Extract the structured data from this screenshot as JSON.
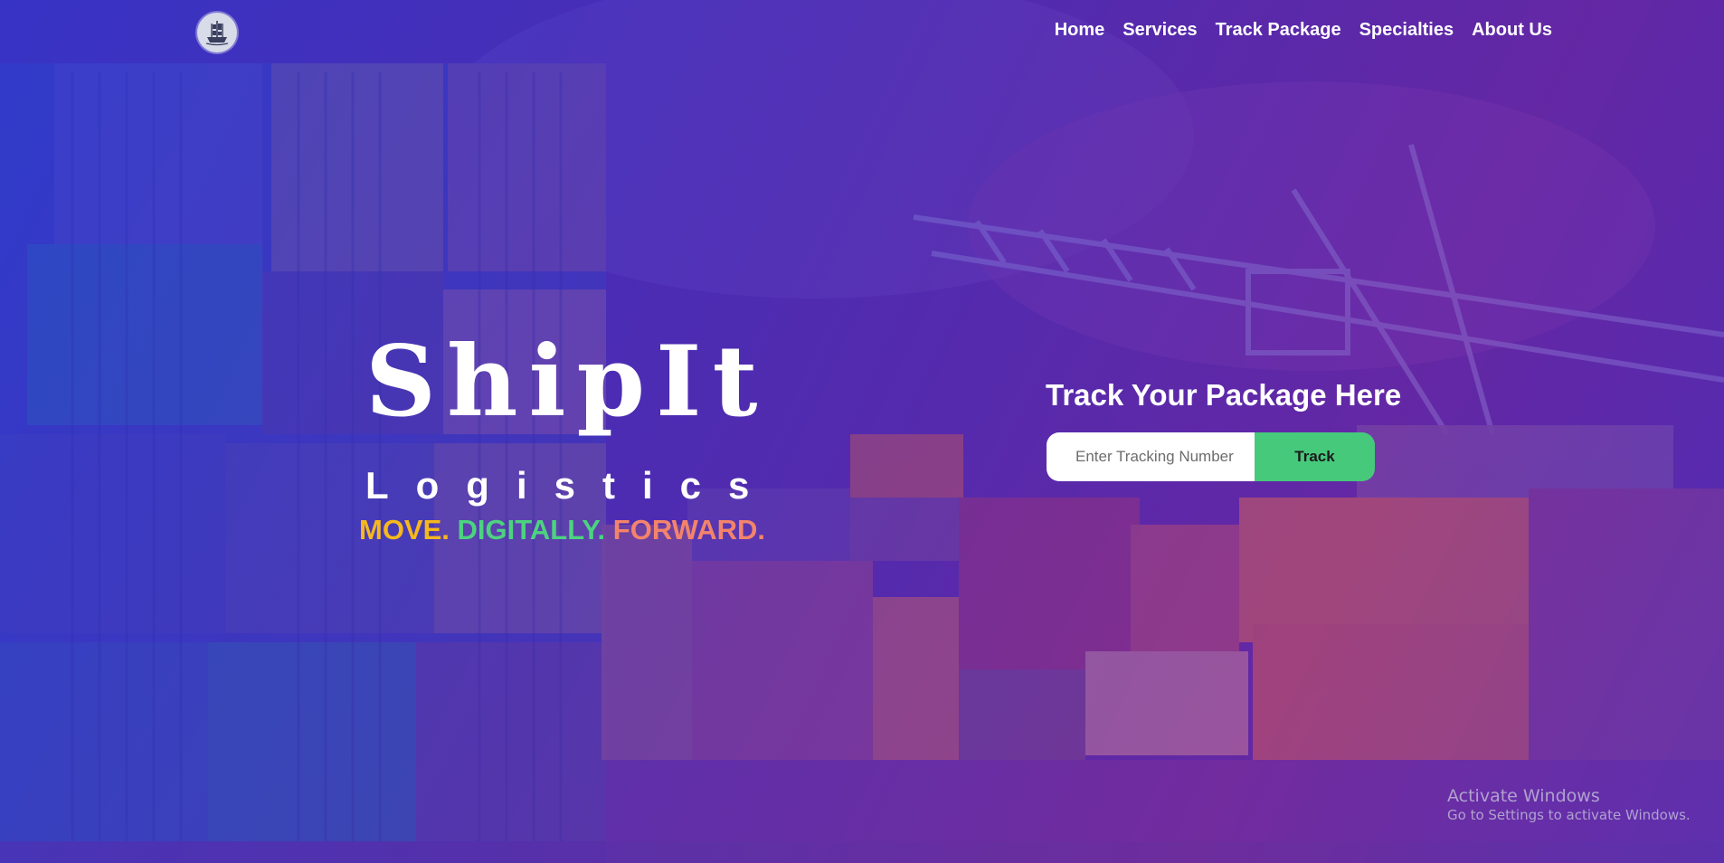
{
  "nav": {
    "logo_icon": "ship-icon",
    "links": [
      "Home",
      "Services",
      "Track Package",
      "Specialties",
      "About Us"
    ]
  },
  "hero": {
    "title": "ShipIt",
    "subtitle": "Logistics",
    "tagline": {
      "move": "MOVE.",
      "digitally": "DIGITALLY.",
      "forward": "FORWARD."
    }
  },
  "tracking": {
    "heading": "Track Your Package Here",
    "placeholder": "Enter Tracking Number",
    "button_label": "Track"
  },
  "watermark": {
    "title": "Activate Windows",
    "subtitle": "Go to Settings to activate Windows."
  },
  "colors": {
    "move": "#f5b81d",
    "digitally": "#4cd37f",
    "forward": "#f3846b",
    "track_button": "#47c97c"
  }
}
